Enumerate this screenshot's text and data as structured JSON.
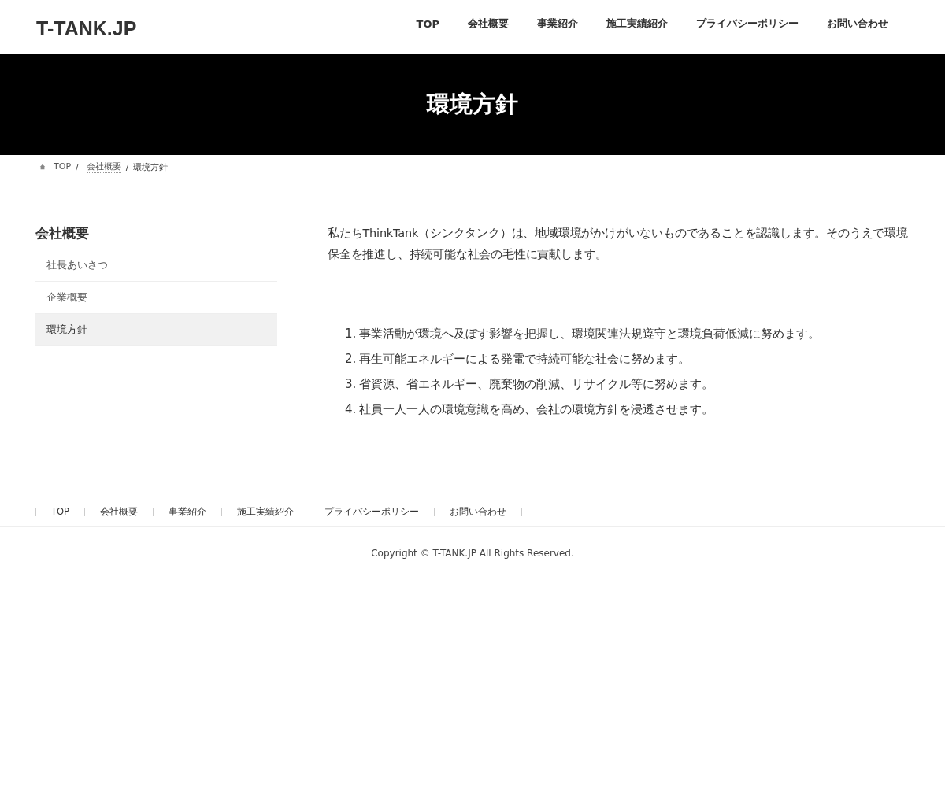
{
  "site_title": "T-TANK.JP",
  "nav": [
    {
      "label": "TOP",
      "selected": false
    },
    {
      "label": "会社概要",
      "selected": true
    },
    {
      "label": "事業紹介",
      "selected": false
    },
    {
      "label": "施工実績紹介",
      "selected": false
    },
    {
      "label": "プライバシーポリシー",
      "selected": false
    },
    {
      "label": "お問い合わせ",
      "selected": false
    }
  ],
  "page_title": "環境方針",
  "breadcrumb": {
    "links": [
      "TOP",
      "会社概要"
    ],
    "separator": "/",
    "current": "環境方針"
  },
  "sidebar": {
    "title": "会社概要",
    "items": [
      {
        "label": "社長あいさつ",
        "selected": false
      },
      {
        "label": "企業概要",
        "selected": false
      },
      {
        "label": "環境方針",
        "selected": true
      }
    ]
  },
  "intro": "私たちThinkTank（シンクタンク）は、地域環境がかけがいないものであることを認識します。そのうえで環境保全を推進し、持続可能な社会の毛性に貢献します。",
  "policies": [
    {
      "number": "1.",
      "text": "事業活動が環境へ及ぼす影響を把握し、環境関連法規遵守と環境負荷低減に努めます。"
    },
    {
      "number": "2.",
      "text": "再生可能エネルギーによる発電で持続可能な社会に努めます。"
    },
    {
      "number": "3.",
      "text": "省資源、省エネルギー、廃棄物の削減、リサイクル等に努めます。"
    },
    {
      "number": "4.",
      "text": "社員一人一人の環境意識を高め、会社の環境方針を浸透させます。"
    }
  ],
  "footer_nav": [
    "TOP",
    "会社概要",
    "事業紹介",
    "施工実績紹介",
    "プライバシーポリシー",
    "お問い合わせ"
  ],
  "copyright": "Copyright © T-TANK.JP All Rights Reserved."
}
